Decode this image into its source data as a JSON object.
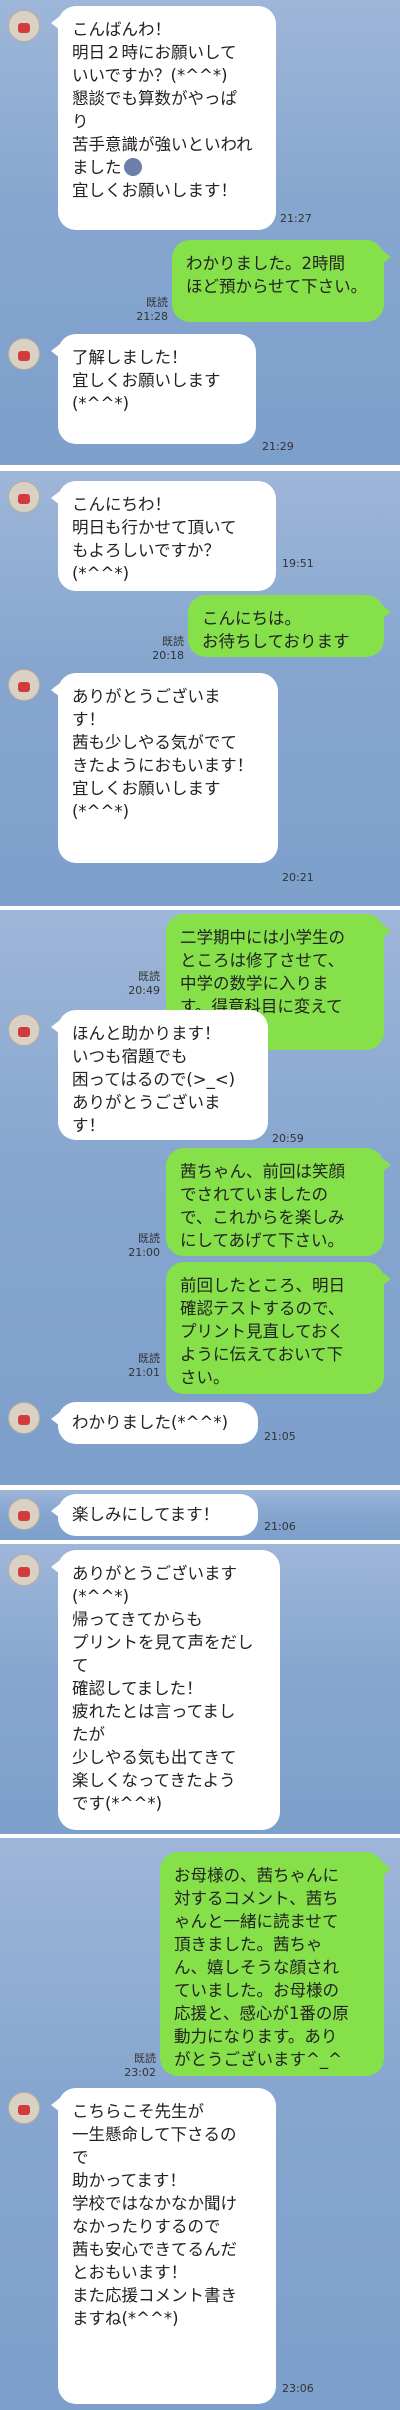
{
  "messages": [
    {
      "text": "こんばんわ！\n明日２時にお願いして\nいいですか？(*^^*)\n懇談でも算数がやっぱ\nり\n苦手意識が強いといわれ\nました",
      "time": "21:27"
    },
    {
      "text": "宜しくお願いします！"
    },
    {
      "text": "わかりました。2時間\nほど預からせて下さい。",
      "read": "既読",
      "time": "21:28"
    },
    {
      "text": "了解しました！\n宜しくお願いします\n(*^^*)",
      "time": "21:29"
    },
    {
      "text": "こんにちわ！\n明日も行かせて頂いて\nもよろしいですか？\n(*^^*)",
      "time": "19:51"
    },
    {
      "text": "こんにちは。\nお待ちしております",
      "read": "既読",
      "time": "20:18"
    },
    {
      "text": "ありがとうございま\nす！\n茜も少しやる気がでて\nきたようにおもいます！\n宜しくお願いします\n(*^^*)",
      "time": "20:21"
    },
    {
      "text": "二学期中には小学生の\nところは修了させて、\n中学の数学に入りま\nす。得意科目に変えて\nいきます！",
      "read": "既読",
      "time": "20:49"
    },
    {
      "text": "ほんと助かります！\nいつも宿題でも\n困ってはるので(>_<)\nありがとうございま\nす！",
      "time": "20:59"
    },
    {
      "text": "茜ちゃん、前回は笑顔\nでされていましたの\nで、これからを楽しみ\nにしてあげて下さい。",
      "read": "既読",
      "time": "21:00"
    },
    {
      "text": "前回したところ、明日\n確認テストするので、\nプリント見直しておく\nように伝えておいて下\nさい。",
      "read": "既読",
      "time": "21:01"
    },
    {
      "text": "わかりました(*^^*)",
      "time": "21:05"
    },
    {
      "text": "楽しみにしてます！",
      "time": "21:06"
    },
    {
      "text": "ありがとうございます\n(*^^*)\n帰ってきてからも\nプリントを見て声をだし\nて\n確認してました！\n疲れたとは言ってまし\nたが\n少しやる気も出てきて\n楽しくなってきたよう\nです(*^^*)"
    },
    {
      "text": "お母様の、茜ちゃんに\n対するコメント、茜ち\nゃんと一緒に読ませて\n頂きました。茜ちゃ\nん、嬉しそうな顔され\nていました。お母様の\n応援と、感心が1番の原\n動力になります。あり\nがとうございます^_^",
      "read": "既読",
      "time": "23:02"
    },
    {
      "text": "こちらこそ先生が\n一生懸命して下さるの\nで\n助かってます！\n学校ではなかなか聞け\nなかったりするので\n茜も安心できてるんだ\nとおもいます！\nまた応援コメント書き\nますね(*^^*)",
      "time": "23:06"
    }
  ],
  "colors": {
    "background": "#86a6cf",
    "incoming_bubble": "#ffffff",
    "outgoing_bubble": "#86e04a",
    "separator": "#ffffff"
  }
}
